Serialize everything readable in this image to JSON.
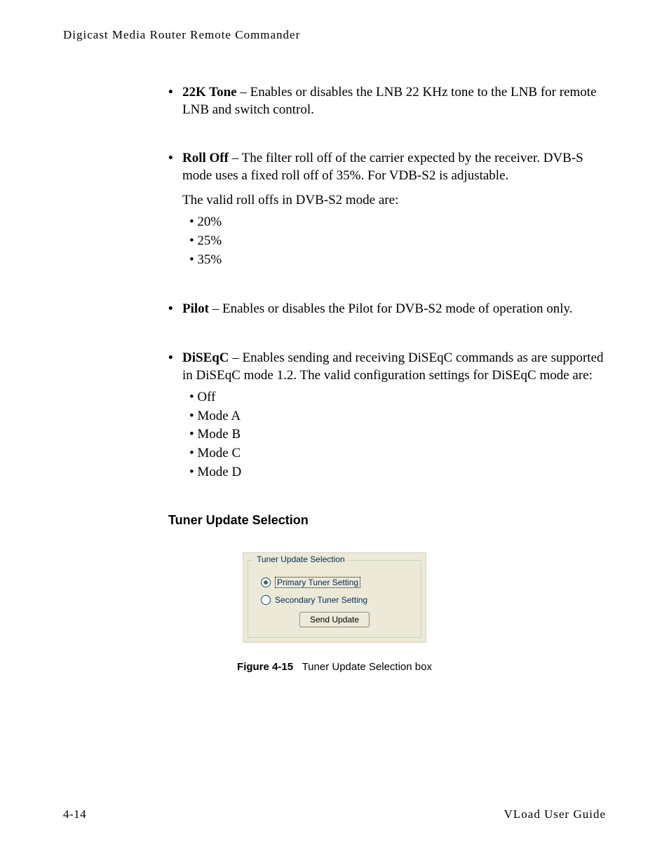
{
  "header": {
    "running_title": "Digicast Media Router Remote Commander"
  },
  "content": {
    "items": [
      {
        "term": "22K Tone",
        "body": " – Enables or disables the LNB 22 KHz tone to the LNB for remote LNB and switch control."
      },
      {
        "term": "Roll Off",
        "body": " – The filter roll off of the carrier expected by the receiver. DVB-S mode uses a fixed roll off of 35%.  For VDB-S2 is adjustable.",
        "sub_intro": "The valid roll offs in DVB-S2 mode are:",
        "sub_items": [
          "20%",
          "25%",
          "35%"
        ]
      },
      {
        "term": "Pilot",
        "body": " – Enables or disables the Pilot for DVB-S2 mode of operation only."
      },
      {
        "term": "DiSEqC",
        "body": " – Enables sending and receiving DiSEqC commands as are supported in DiSEqC mode 1.2. The valid configuration settings for DiSEqC mode are:",
        "sub_items": [
          "Off",
          "Mode A",
          "Mode B",
          "Mode C",
          "Mode D"
        ]
      }
    ],
    "section_heading": "Tuner Update Selection"
  },
  "ui_box": {
    "group_title": "Tuner Update Selection",
    "radio1": {
      "label": "Primary Tuner Setting",
      "checked": true
    },
    "radio2": {
      "label": "Secondary Tuner Setting",
      "checked": false
    },
    "button_label": "Send Update"
  },
  "figure": {
    "number": "Figure 4-15",
    "caption": "Tuner Update Selection box"
  },
  "footer": {
    "page_number": "4-14",
    "guide_title": "VLoad User Guide"
  }
}
